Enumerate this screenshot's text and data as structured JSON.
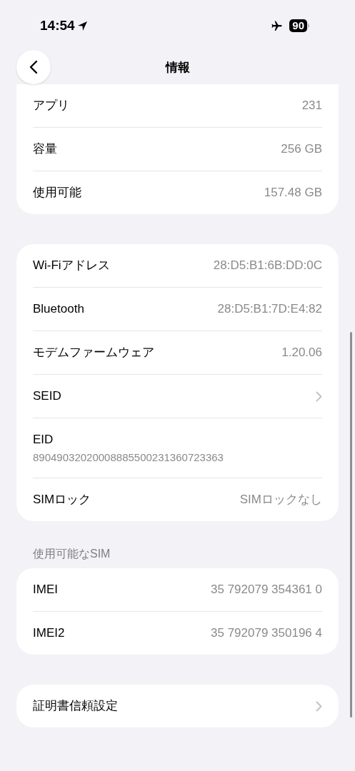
{
  "status_bar": {
    "time": "14:54",
    "battery": "90"
  },
  "nav": {
    "title": "情報"
  },
  "groups": [
    {
      "rows": [
        {
          "kind": "value",
          "label": "アプリ",
          "value": "231"
        },
        {
          "kind": "value",
          "label": "容量",
          "value": "256 GB"
        },
        {
          "kind": "value",
          "label": "使用可能",
          "value": "157.48 GB"
        }
      ]
    },
    {
      "rows": [
        {
          "kind": "value",
          "label": "Wi-Fiアドレス",
          "value": "28:D5:B1:6B:DD:0C"
        },
        {
          "kind": "value",
          "label": "Bluetooth",
          "value": "28:D5:B1:7D:E4:82"
        },
        {
          "kind": "value",
          "label": "モデムファームウェア",
          "value": "1.20.06"
        },
        {
          "kind": "link",
          "label": "SEID"
        },
        {
          "kind": "stacked",
          "label": "EID",
          "value": "89049032020008885500231360723363"
        },
        {
          "kind": "value",
          "label": "SIMロック",
          "value": "SIMロックなし"
        }
      ]
    },
    {
      "header": "使用可能なSIM",
      "rows": [
        {
          "kind": "value",
          "label": "IMEI",
          "value": "35 792079 354361 0"
        },
        {
          "kind": "value",
          "label": "IMEI2",
          "value": "35 792079 350196 4"
        }
      ]
    },
    {
      "rows": [
        {
          "kind": "link",
          "label": "証明書信頼設定"
        }
      ]
    }
  ]
}
